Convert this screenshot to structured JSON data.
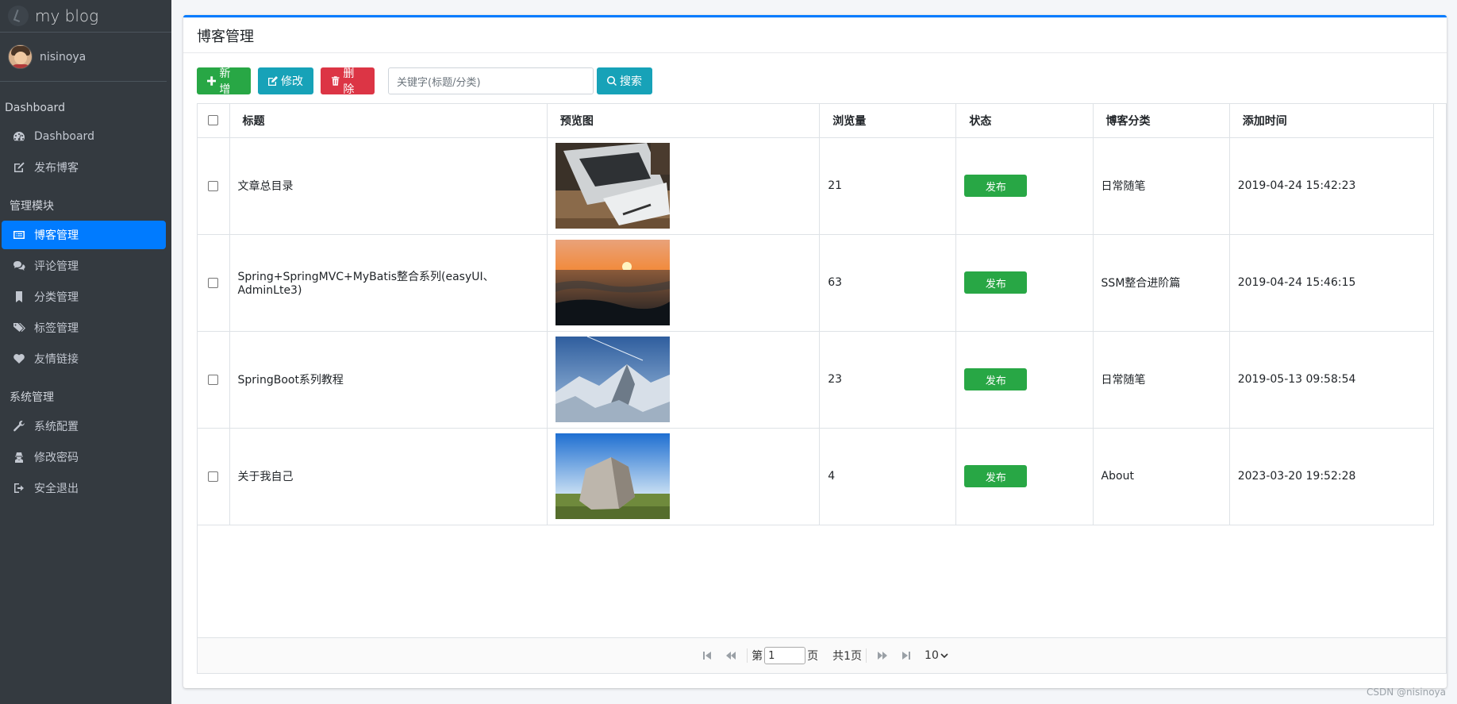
{
  "brand": {
    "title": "my blog"
  },
  "user": {
    "name": "nisinoya"
  },
  "sidebar": {
    "sections": [
      {
        "header": "Dashboard",
        "items": [
          {
            "label": "Dashboard",
            "icon": "dashboard-icon",
            "active": false
          },
          {
            "label": "发布博客",
            "icon": "edit-icon",
            "active": false
          }
        ]
      },
      {
        "header": "管理模块",
        "items": [
          {
            "label": "博客管理",
            "icon": "list-icon",
            "active": true
          },
          {
            "label": "评论管理",
            "icon": "comments-icon",
            "active": false
          },
          {
            "label": "分类管理",
            "icon": "bookmark-icon",
            "active": false
          },
          {
            "label": "标签管理",
            "icon": "tags-icon",
            "active": false
          },
          {
            "label": "友情链接",
            "icon": "heart-icon",
            "active": false
          }
        ]
      },
      {
        "header": "系统管理",
        "items": [
          {
            "label": "系统配置",
            "icon": "wrench-icon",
            "active": false
          },
          {
            "label": "修改密码",
            "icon": "user-secret-icon",
            "active": false
          },
          {
            "label": "安全退出",
            "icon": "sign-out-icon",
            "active": false
          }
        ]
      }
    ]
  },
  "page": {
    "title": "博客管理"
  },
  "toolbar": {
    "add_label": "新增",
    "edit_label": "修改",
    "delete_label": "删除",
    "search_placeholder": "关键字(标题/分类)",
    "search_label": "搜索"
  },
  "table": {
    "columns": [
      "标题",
      "预览图",
      "浏览量",
      "状态",
      "博客分类",
      "添加时间"
    ],
    "rows": [
      {
        "title": "文章总目录",
        "image": "laptop-photo",
        "views": "21",
        "status": "发布",
        "category": "日常随笔",
        "time": "2019-04-24 15:42:23"
      },
      {
        "title": "Spring+SpringMVC+MyBatis整合系列(easyUI、AdminLte3)",
        "image": "sunset-sea-photo",
        "views": "63",
        "status": "发布",
        "category": "SSM整合进阶篇",
        "time": "2019-04-24 15:46:15"
      },
      {
        "title": "SpringBoot系列教程",
        "image": "snowy-mountains-photo",
        "views": "23",
        "status": "发布",
        "category": "日常随笔",
        "time": "2019-05-13 09:58:54"
      },
      {
        "title": "关于我自己",
        "image": "rock-field-photo",
        "views": "4",
        "status": "发布",
        "category": "About",
        "time": "2023-03-20 19:52:28"
      }
    ]
  },
  "pager": {
    "page_prefix": "第",
    "page_value": "1",
    "page_suffix": "页",
    "total_label": "共1页",
    "page_size": "10"
  },
  "watermark": "CSDN @nisinoya",
  "colors": {
    "primary": "#007bff",
    "success": "#28a745",
    "info": "#17a2b8",
    "danger": "#dc3545",
    "sidebar": "#343a40"
  }
}
